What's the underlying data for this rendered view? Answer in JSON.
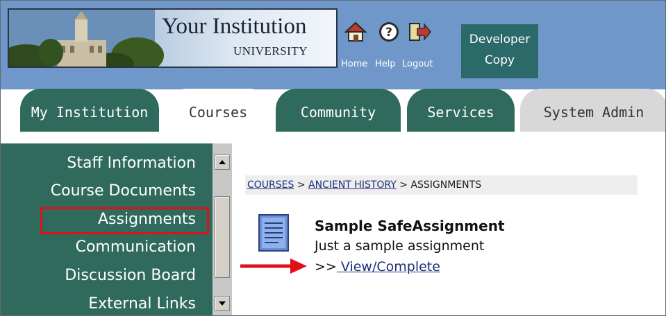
{
  "header": {
    "logo_title": "Your Institution",
    "logo_subtitle": "UNIVERSITY",
    "nav_icons": [
      {
        "label": "Home",
        "icon": "home-icon"
      },
      {
        "label": "Help",
        "icon": "help-icon"
      },
      {
        "label": "Logout",
        "icon": "logout-icon"
      }
    ],
    "dev_copy_line1": "Developer",
    "dev_copy_line2": "Copy"
  },
  "tabs": [
    {
      "label": "My Institution",
      "state": "normal"
    },
    {
      "label": "Courses",
      "state": "active"
    },
    {
      "label": "Community",
      "state": "normal"
    },
    {
      "label": "Services",
      "state": "normal"
    },
    {
      "label": "System Admin",
      "state": "disabled"
    }
  ],
  "course_menu": {
    "items": [
      {
        "label": "Staff Information"
      },
      {
        "label": "Course Documents"
      },
      {
        "label": "Assignments",
        "selected": true
      },
      {
        "label": "Communication"
      },
      {
        "label": "Discussion Board"
      },
      {
        "label": "External Links"
      }
    ]
  },
  "breadcrumb": {
    "items": [
      "COURSES",
      "ANCIENT HISTORY",
      "ASSIGNMENTS"
    ],
    "separator": ">"
  },
  "assignment": {
    "title": "Sample SafeAssignment",
    "description": "Just a sample assignment",
    "link_prefix": ">>",
    "link_label": " View/Complete"
  },
  "colors": {
    "header_bg": "#6f97c9",
    "nav_green": "#2f6a5c",
    "highlight_red": "#e0101a",
    "dev_copy_bg": "#2c6a6a"
  }
}
